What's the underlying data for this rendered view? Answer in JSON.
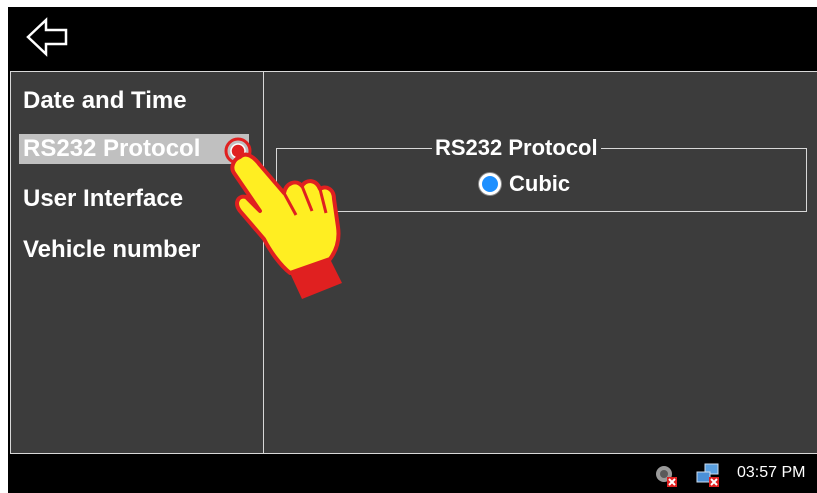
{
  "topbar": {
    "back_icon": "back-arrow-icon"
  },
  "sidebar": {
    "items": [
      {
        "label": "Date and Time"
      },
      {
        "label": "RS232 Protocol",
        "selected": true
      },
      {
        "label": "User Interface"
      },
      {
        "label": "Vehicle number"
      }
    ]
  },
  "main": {
    "group_title": "RS232 Protocol",
    "options": [
      {
        "label": "Cubic",
        "selected": true
      }
    ]
  },
  "overlay": {
    "pointer_icon": "tap-hand-icon"
  },
  "taskbar": {
    "icons": [
      "volume-muted-icon",
      "network-disconnected-icon"
    ],
    "time": "03:57 PM"
  },
  "colors": {
    "panel_bg": "#3c3c3c",
    "selected_bg": "#c0c0c0",
    "radio_accent": "#1e90ff",
    "hand_fill": "#ffee22",
    "hand_outline": "#e02020"
  }
}
